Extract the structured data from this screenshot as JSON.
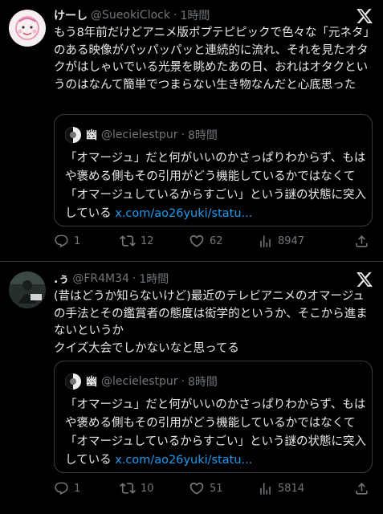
{
  "tweets": [
    {
      "display_name": "けーし",
      "handle": "@SueokiClock",
      "separator": "·",
      "time": "1時間",
      "text": "もう8年前だけどアニメ版ポプテピピックで色々な「元ネタ」のある映像がパッパッパッと連続的に流れ、それを見たオタクがはしゃいでいる光景を眺めたあの日、おれはオタクというのはなんて簡単でつまらない生き物なんだと心底思った",
      "quote": {
        "display_name": "幽",
        "handle": "@lecielestpur",
        "separator": "·",
        "time": "8時間",
        "text": "「オマージュ」だと何がいいのかさっぱりわからず、もはや褒める側もその引用がどう機能しているかではなくて「オマージュしているからすごい」という謎の状態に突入している ",
        "link": "x.com/ao26yuki/statu..."
      },
      "replies": "1",
      "retweets": "12",
      "likes": "62",
      "views": "8947"
    },
    {
      "display_name": ".ぅ",
      "handle": "@FR4M34",
      "separator": "·",
      "time": "1時間",
      "text": "(昔はどうか知らないけど)最近のテレビアニメのオマージュの手法とその鑑賞者の態度は衒学的というか、そこから進まないというか\nクイズ大会でしかないなと思ってる",
      "quote": {
        "display_name": "幽",
        "handle": "@lecielestpur",
        "separator": "·",
        "time": "8時間",
        "text": "「オマージュ」だと何がいいのかさっぱりわからず、もはや褒める側もその引用がどう機能しているかではなくて「オマージュしているからすごい」という謎の状態に突入している ",
        "link": "x.com/ao26yuki/statu..."
      },
      "replies": "1",
      "retweets": "10",
      "likes": "51",
      "views": "5814"
    }
  ],
  "icons": {
    "logo": "x-logo-icon",
    "reply": "reply-icon",
    "retweet": "retweet-icon",
    "like": "like-icon",
    "views": "views-icon",
    "share": "share-icon"
  },
  "colors": {
    "background": "#000000",
    "text": "#e7e9ea",
    "muted": "#71767b",
    "link": "#1d9bf0",
    "border": "#2f3336"
  }
}
